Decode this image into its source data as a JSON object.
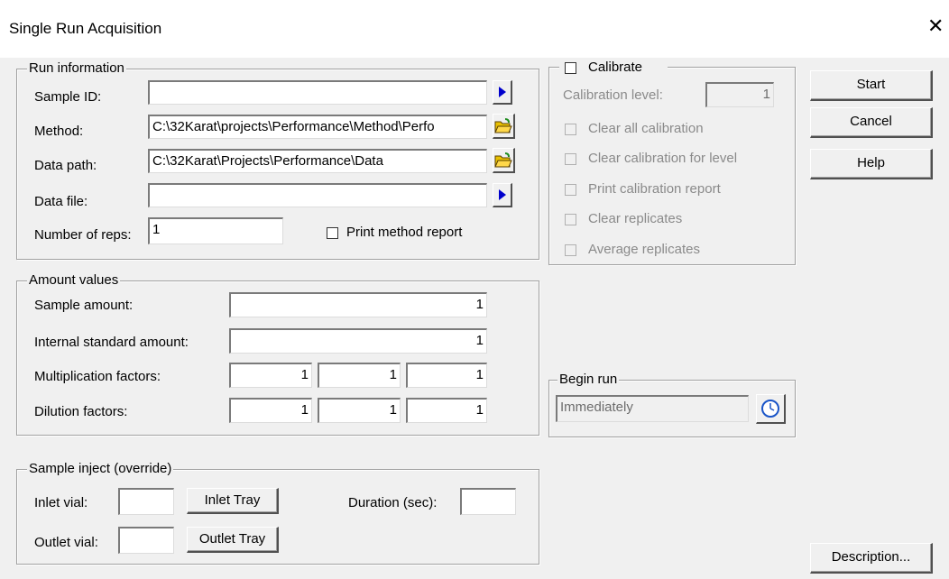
{
  "window": {
    "title": "Single Run Acquisition",
    "close_glyph": "✕"
  },
  "run_info": {
    "legend": "Run information",
    "sample_id": {
      "label": "Sample ID:",
      "value": ""
    },
    "method": {
      "label": "Method:",
      "value": "C:\\32Karat\\projects\\Performance\\Method\\Perfo"
    },
    "data_path": {
      "label": "Data path:",
      "value": "C:\\32Karat\\Projects\\Performance\\Data"
    },
    "data_file": {
      "label": "Data file:",
      "value": ""
    },
    "reps": {
      "label": "Number of reps:",
      "value": "1"
    },
    "print_method_report": {
      "label": "Print method report",
      "checked": false
    }
  },
  "calibrate": {
    "label": "Calibrate",
    "checked": false,
    "level_label": "Calibration level:",
    "level_value": "1",
    "options": [
      "Clear all calibration",
      "Clear calibration for level",
      "Print calibration report",
      "Clear replicates",
      "Average replicates"
    ]
  },
  "buttons": {
    "start": "Start",
    "cancel": "Cancel",
    "help": "Help",
    "description": "Description..."
  },
  "amounts": {
    "legend": "Amount values",
    "sample_amount": {
      "label": "Sample amount:",
      "value": "1"
    },
    "istd_amount": {
      "label": "Internal standard amount:",
      "value": "1"
    },
    "multiplication": {
      "label": "Multiplication factors:",
      "values": [
        "1",
        "1",
        "1"
      ]
    },
    "dilution": {
      "label": "Dilution factors:",
      "values": [
        "1",
        "1",
        "1"
      ]
    }
  },
  "begin_run": {
    "legend": "Begin run",
    "value": "Immediately"
  },
  "inject": {
    "legend": "Sample inject (override)",
    "inlet_label": "Inlet vial:",
    "inlet_value": "",
    "inlet_tray": "Inlet Tray",
    "outlet_label": "Outlet vial:",
    "outlet_value": "",
    "outlet_tray": "Outlet Tray",
    "duration_label": "Duration (sec):",
    "duration_value": ""
  },
  "colors": {
    "arrow": "#0000cc",
    "folder": "#e8c000",
    "folder_bg": "#1e8c1e",
    "clock": "#1a55c8"
  }
}
